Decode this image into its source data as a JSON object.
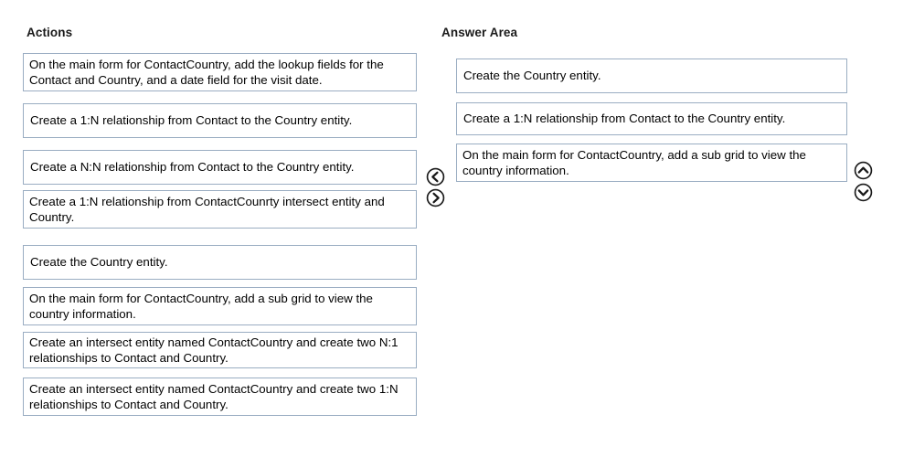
{
  "headings": {
    "actions": "Actions",
    "answer_area": "Answer Area"
  },
  "colors": {
    "box_border": "#9aadc2",
    "page_background": "#ffffff",
    "text": "#000000",
    "heading_text": "#1a1a1a",
    "arrow_stroke": "#1a1a1a"
  },
  "actions": {
    "items": [
      {
        "text": "On the main form for ContactCountry, add the lookup fields for the Contact and Country, and a date field for the visit date.",
        "lines": 2
      },
      {
        "text": "Create a 1:N relationship from Contact to the Country entity.",
        "lines": 1
      },
      {
        "text": "Create a N:N relationship from Contact to the Country entity.",
        "lines": 1
      },
      {
        "text": "Create a 1:N relationship from ContactCounrty intersect entity and Country.",
        "lines": 2
      },
      {
        "text": "Create the Country entity.",
        "lines": 1
      },
      {
        "text": "On the main form for ContactCountry, add a sub grid to view the country information.",
        "lines": 2
      },
      {
        "text": "Create an intersect entity named ContactCountry and create two N:1 relationships to Contact and Country.",
        "lines": 2
      },
      {
        "text": "Create an intersect entity named ContactCountry and create two 1:N relationships to Contact and Country.",
        "lines": 2
      }
    ]
  },
  "answer_area": {
    "items": [
      {
        "text": "Create the Country entity.",
        "lines": 1
      },
      {
        "text": "Create a 1:N relationship from Contact to the Country entity.",
        "lines": 1
      },
      {
        "text": "On the main form for ContactCountry, add a sub grid to view the country information.",
        "lines": 2
      }
    ]
  },
  "controls": {
    "move_left": "move-left-icon",
    "move_right": "move-right-icon",
    "move_up": "move-up-icon",
    "move_down": "move-down-icon"
  }
}
